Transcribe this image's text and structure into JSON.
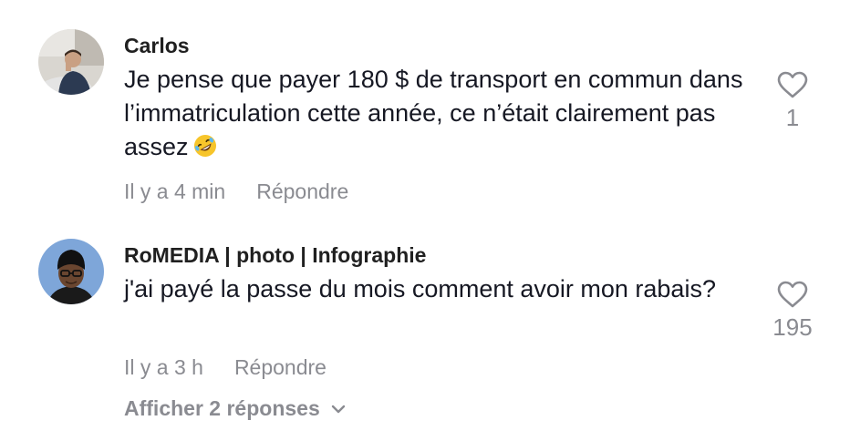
{
  "comments": [
    {
      "username": "Carlos",
      "text": "Je pense que payer 180 $ de transport en commun dans l’immatriculation cette année, ce n’était clairement pas assez",
      "emoji": "rolling-on-floor-laughing-emoji",
      "time": "Il y a 4 min",
      "reply_label": "Répondre",
      "likes": "1"
    },
    {
      "username": "RoMEDIA | photo | Infographie",
      "text": "j'ai payé la passe du mois comment avoir mon rabais?",
      "time": "Il y a 3 h",
      "reply_label": "Répondre",
      "likes": "195",
      "show_replies_label": "Afficher 2 réponses"
    }
  ],
  "icons": {
    "like": "heart-outline-icon",
    "expand": "chevron-down-icon"
  },
  "colors": {
    "text": "#161823",
    "muted": "#8a8b91",
    "background": "#ffffff"
  }
}
